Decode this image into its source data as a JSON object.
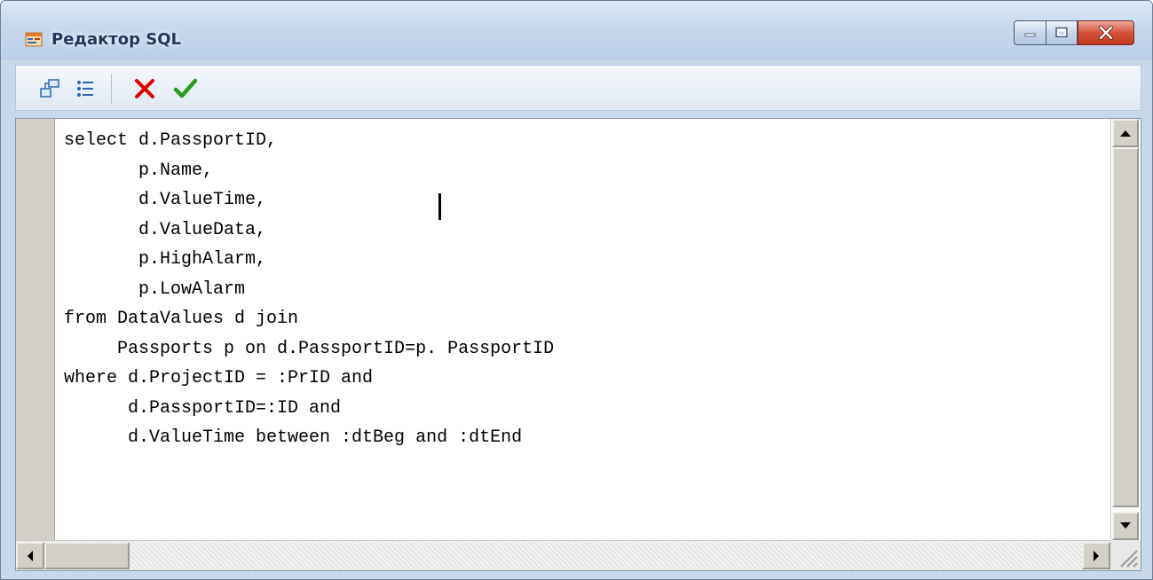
{
  "window": {
    "title": "Редактор SQL",
    "controls": [
      "minimize-icon",
      "maximize-icon",
      "close-icon"
    ]
  },
  "toolbar": {
    "buttons": [
      {
        "icon": "query-builder-icon",
        "interactable": true
      },
      {
        "icon": "list-icon",
        "interactable": true
      },
      {
        "icon": "cancel-icon",
        "color": "#e00000",
        "interactable": true
      },
      {
        "icon": "ok-check-icon",
        "color": "#2e9b1f",
        "interactable": true
      }
    ]
  },
  "editor": {
    "lines": [
      "select d.PassportID,",
      "       p.Name,",
      "       d.ValueTime,",
      "       d.ValueData,",
      "       p.HighAlarm,",
      "       p.LowAlarm",
      "from DataValues d join",
      "     Passports p on d.PassportID=p. PassportID",
      "where d.ProjectID = :PrID and",
      "      d.PassportID=:ID and",
      "      d.ValueTime between :dtBeg and :dtEnd"
    ]
  },
  "colors": {
    "title_text": "#1e395b",
    "close_button": "#c94a32",
    "gutter": "#d4d0c8"
  }
}
